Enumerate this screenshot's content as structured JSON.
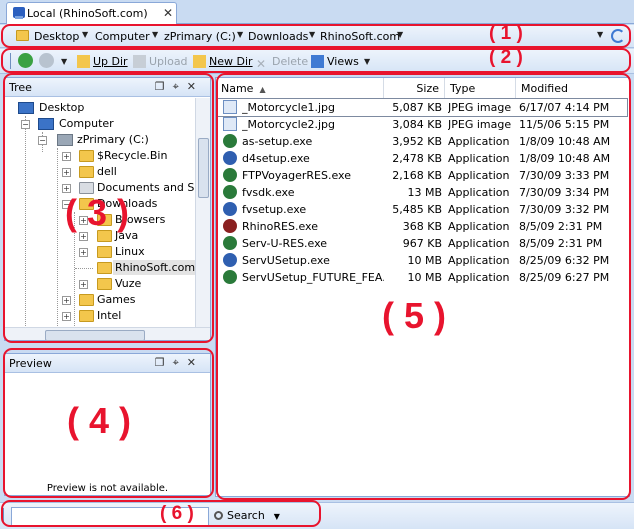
{
  "tab": {
    "label": "Local (RhinoSoft.com)",
    "close": "✕"
  },
  "address": {
    "crumbs": [
      "Desktop",
      "Computer",
      "zPrimary (C:)",
      "Downloads",
      "RhinoSoft.com"
    ]
  },
  "toolbar": {
    "back": "back",
    "forward": "forward",
    "up_dir": "Up Dir",
    "upload": "Upload",
    "new_dir": "New Dir",
    "delete": "Delete",
    "views": "Views"
  },
  "tree": {
    "title": "Tree",
    "items": [
      "Desktop",
      "Computer",
      "zPrimary (C:)",
      "$Recycle.Bin",
      "dell",
      "Documents and Settings",
      "Downloads",
      "Browsers",
      "Java",
      "Linux",
      "RhinoSoft.com",
      "Vuze",
      "Games",
      "Intel"
    ]
  },
  "preview": {
    "title": "Preview",
    "message": "Preview is not available."
  },
  "panel_buttons": {
    "float": "❐",
    "pin": "⌖",
    "close": "✕"
  },
  "list": {
    "columns": {
      "name": "Name",
      "size": "Size",
      "type": "Type",
      "modified": "Modified"
    },
    "rows": [
      {
        "name": "_Motorcycle1.jpg",
        "size": "5,087 KB",
        "type": "JPEG image",
        "modified": "6/17/07 4:14 PM",
        "icon": "image"
      },
      {
        "name": "_Motorcycle2.jpg",
        "size": "3,084 KB",
        "type": "JPEG image",
        "modified": "11/5/06 5:15 PM",
        "icon": "image"
      },
      {
        "name": "as-setup.exe",
        "size": "3,952 KB",
        "type": "Application",
        "modified": "1/8/09 10:48 AM",
        "icon": "app"
      },
      {
        "name": "d4setup.exe",
        "size": "2,478 KB",
        "type": "Application",
        "modified": "1/8/09 10:48 AM",
        "icon": "app"
      },
      {
        "name": "FTPVoyagerRES.exe",
        "size": "2,168 KB",
        "type": "Application",
        "modified": "7/30/09 3:33 PM",
        "icon": "app"
      },
      {
        "name": "fvsdk.exe",
        "size": "13 MB",
        "type": "Application",
        "modified": "7/30/09 3:34 PM",
        "icon": "app"
      },
      {
        "name": "fvsetup.exe",
        "size": "5,485 KB",
        "type": "Application",
        "modified": "7/30/09 3:32 PM",
        "icon": "app"
      },
      {
        "name": "RhinoRES.exe",
        "size": "368 KB",
        "type": "Application",
        "modified": "8/5/09 2:31 PM",
        "icon": "rhino"
      },
      {
        "name": "Serv-U-RES.exe",
        "size": "967 KB",
        "type": "Application",
        "modified": "8/5/09 2:31 PM",
        "icon": "app"
      },
      {
        "name": "ServUSetup.exe",
        "size": "10 MB",
        "type": "Application",
        "modified": "8/25/09 6:32 PM",
        "icon": "app"
      },
      {
        "name": "ServUSetup_FUTURE_FEA...",
        "size": "10 MB",
        "type": "Application",
        "modified": "8/25/09 6:27 PM",
        "icon": "app"
      }
    ]
  },
  "search": {
    "value": "",
    "button": "Search"
  },
  "annotations": [
    "( 1 )",
    "( 2 )",
    "( 3 )",
    "( 4 )",
    "( 5 )",
    "( 6 )"
  ],
  "colors": {
    "annotation": "#e8142e",
    "chrome": "#c9dbf2",
    "accent": "#3f7ad3"
  }
}
